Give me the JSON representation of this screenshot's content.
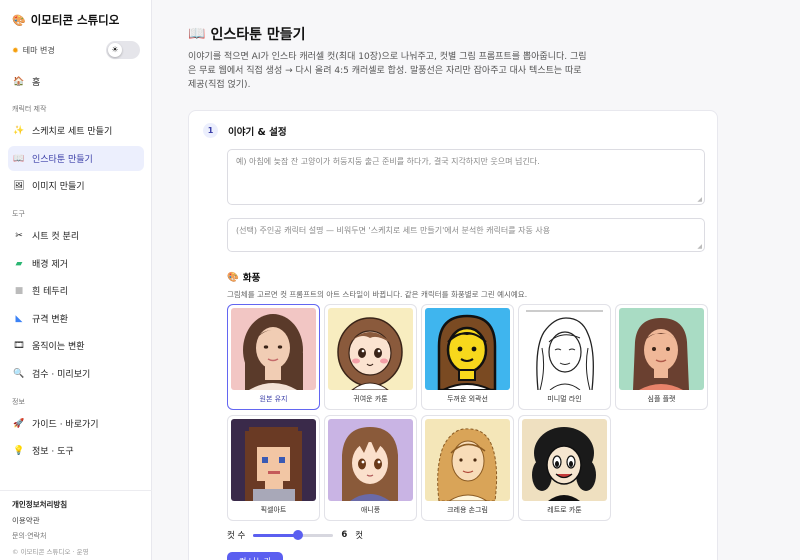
{
  "sidebar": {
    "brand": "이모티콘 스튜디오",
    "brand_icon": "palette-icon",
    "theme_label": "테마 변경",
    "theme_icon": "sun-icon",
    "home": "홈",
    "sections": {
      "character": "캐릭터 제작",
      "tools": "도구",
      "info": "정보"
    },
    "items": [
      {
        "label": "스케치로 세트 만들기",
        "icon": "sparkle-icon",
        "active": false
      },
      {
        "label": "인스타툰 만들기",
        "icon": "book-icon",
        "active": true
      },
      {
        "label": "이미지 만들기",
        "icon": "image-icon",
        "active": false
      },
      {
        "label": "시트 컷 분리",
        "icon": "scissors-icon",
        "active": false
      },
      {
        "label": "배경 제거",
        "icon": "eraser-icon",
        "active": false
      },
      {
        "label": "흰 테두리",
        "icon": "square-icon",
        "active": false
      },
      {
        "label": "규격 변환",
        "icon": "ruler-icon",
        "active": false
      },
      {
        "label": "움직이는 변환",
        "icon": "film-icon",
        "active": false
      },
      {
        "label": "검수 · 미리보기",
        "icon": "magnifier-icon",
        "active": false
      },
      {
        "label": "가이드 · 바로가기",
        "icon": "rocket-icon",
        "active": false
      },
      {
        "label": "정보 · 도구",
        "icon": "bulb-icon",
        "active": false
      }
    ],
    "footer": {
      "privacy": "개인정보처리방침",
      "terms": "이용약관",
      "contact": "문의·연락처",
      "copyright": "© 이모티콘 스튜디오 · 운영"
    }
  },
  "main": {
    "title": "인스타툰 만들기",
    "title_icon": "book-icon",
    "description": "이야기를 적으면 AI가 인스타 캐러셀 컷(최대 10장)으로 나눠주고, 컷별 그림 프롬프트를 뽑아줍니다. 그림은 무료 웹에서 직접 생성 → 다시 올려 4:5 캐러셀로 합성. 말풍선은 자리만 잡아주고 대사 텍스트는 따로 제공(직접 얹기).",
    "step": {
      "number": "1",
      "label": "이야기 & 설정"
    },
    "story_placeholder": "예) 아침에 늦잠 잔 고양이가 허둥지둥 출근 준비를 하다가, 결국 지각하지만 웃으며 넘긴다.",
    "character_placeholder": "(선택) 주인공 캐릭터 설명 — 비워두면 '스케치로 세트 만들기'에서 분석한 캐릭터를 자동 사용",
    "style_title": "화풍",
    "style_icon": "palette-icon",
    "style_desc": "그림체를 고르면 컷 프롬프트의 아트 스타일이 바뀝니다. 같은 캐릭터를 화풍별로 그린 예시예요.",
    "styles": [
      {
        "label": "원본 유지",
        "selected": true
      },
      {
        "label": "귀여운 카툰",
        "selected": false
      },
      {
        "label": "두꺼운 외곽선",
        "selected": false
      },
      {
        "label": "미니멀 라인",
        "selected": false
      },
      {
        "label": "심플 플랫",
        "selected": false
      },
      {
        "label": "픽셀아트",
        "selected": false
      },
      {
        "label": "애니풍",
        "selected": false
      },
      {
        "label": "크레용 손그림",
        "selected": false
      },
      {
        "label": "레트로 카툰",
        "selected": false
      }
    ],
    "cut_count_label": "컷 수",
    "cut_count": 6,
    "cut_count_min": 1,
    "cut_count_max": 10,
    "cut_count_unit": "컷",
    "action_button": "컷 나누기"
  },
  "colors": {
    "accent": "#5b5ff0",
    "active_bg": "#eceffd"
  }
}
